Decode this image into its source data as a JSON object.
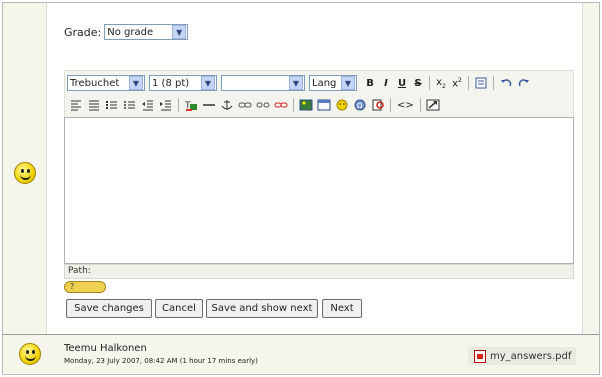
{
  "grade": {
    "label": "Grade:",
    "value": "No grade"
  },
  "toolbar": {
    "font": "Trebuchet",
    "size": "1 (8 pt)",
    "style": "",
    "lang": "Lang",
    "bold": "B",
    "italic": "I",
    "underline": "U",
    "strike": "S",
    "sub": "x",
    "sup": "x",
    "code": "<>"
  },
  "path_label": "Path:",
  "help_badge": "?",
  "buttons": {
    "save_changes": "Save changes",
    "cancel": "Cancel",
    "save_show_next": "Save and show next",
    "next": "Next"
  },
  "submission": {
    "name": "Teemu Halkonen",
    "date": "Monday, 23 July 2007, 08:42 AM (1 hour 17 mins early)",
    "file": "my_answers.pdf"
  }
}
